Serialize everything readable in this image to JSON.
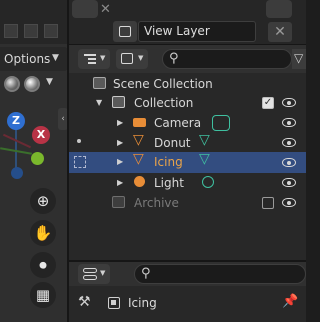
{
  "viewport": {
    "options_label": "Options",
    "axis": {
      "z": "Z",
      "x": "X"
    },
    "colors": {
      "z": "#2f6fd1",
      "x": "#b83346",
      "y": "#7ab82c"
    }
  },
  "header": {
    "view_layer": "View Layer"
  },
  "outliner": {
    "search_placeholder": "",
    "rows": [
      {
        "label": "Scene Collection",
        "icon": "scene-collection-icon"
      },
      {
        "label": "Collection",
        "icon": "collection-icon",
        "checked": true
      },
      {
        "label": "Camera",
        "icon": "camera-object-icon",
        "data_icon": "camera-data-icon"
      },
      {
        "label": "Donut",
        "icon": "mesh-object-icon",
        "data_icon": "mesh-data-icon"
      },
      {
        "label": "Icing",
        "icon": "mesh-object-icon",
        "data_icon": "mesh-data-icon",
        "selected": true
      },
      {
        "label": "Light",
        "icon": "light-object-icon",
        "data_icon": "light-data-icon"
      },
      {
        "label": "Archive",
        "icon": "collection-icon",
        "checked": false,
        "excluded": true
      }
    ]
  },
  "properties": {
    "object_name": "Icing"
  },
  "colors": {
    "selected_row": "#334d80",
    "selected_text": "#e8a34a",
    "data_green": "#3fc0a0",
    "object_orange": "#e88d37"
  }
}
